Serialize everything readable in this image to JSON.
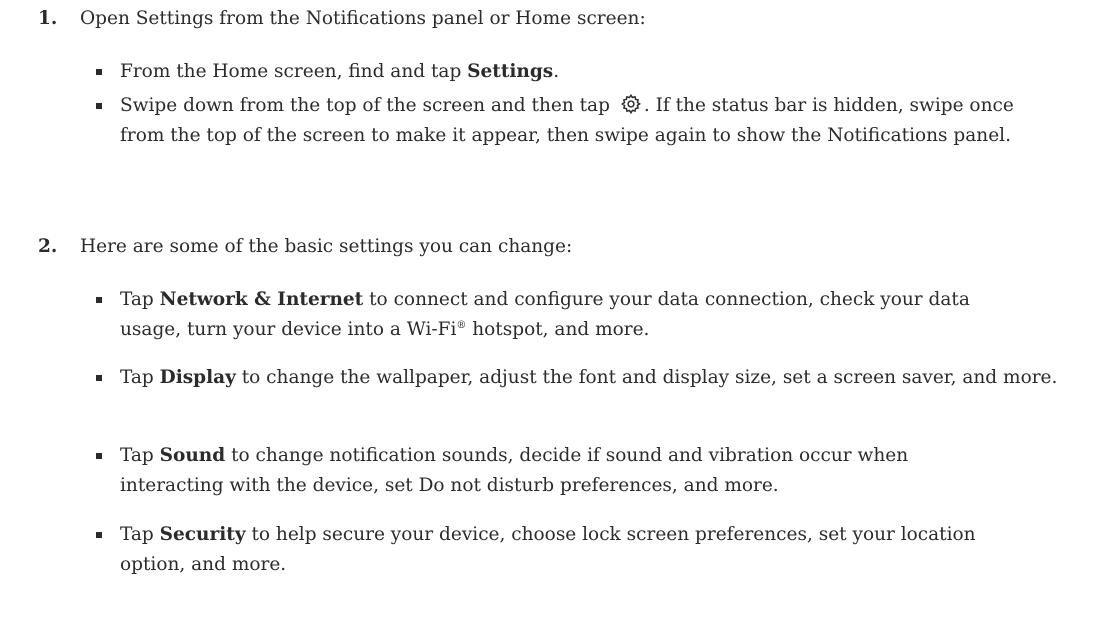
{
  "steps": [
    {
      "number": "1.",
      "text": "Open Settings from the Notifications panel or Home screen:",
      "bullets": [
        {
          "pre": "From the Home screen, find and tap ",
          "bold": "Settings",
          "post": "."
        },
        {
          "pre": "Swipe down from the top of the screen and then tap ",
          "icon": "gear-icon",
          "post": ". If the status bar is hidden, swipe once from the top of the screen to make it appear, then swipe again to show the Notifications panel."
        }
      ]
    },
    {
      "number": "2.",
      "text": "Here are some of the basic settings you can change:",
      "bullets": [
        {
          "pre": "Tap ",
          "bold": "Network & Internet",
          "post1": " to connect and configure your data connection, check your data usage, turn your device into a Wi-Fi",
          "sup": "®",
          "post2": " hotspot, and more."
        },
        {
          "pre": "Tap ",
          "bold": "Display",
          "post": " to change the wallpaper, adjust the font and display size, set a screen saver, and more."
        },
        {
          "pre": "Tap ",
          "bold": "Sound",
          "post": " to change notification sounds, decide if sound and vibration occur when interacting with the device, set Do not disturb preferences, and more."
        },
        {
          "pre": "Tap ",
          "bold": "Security",
          "post": " to help secure your device, choose lock screen preferences, set your location option, and more."
        }
      ]
    }
  ]
}
